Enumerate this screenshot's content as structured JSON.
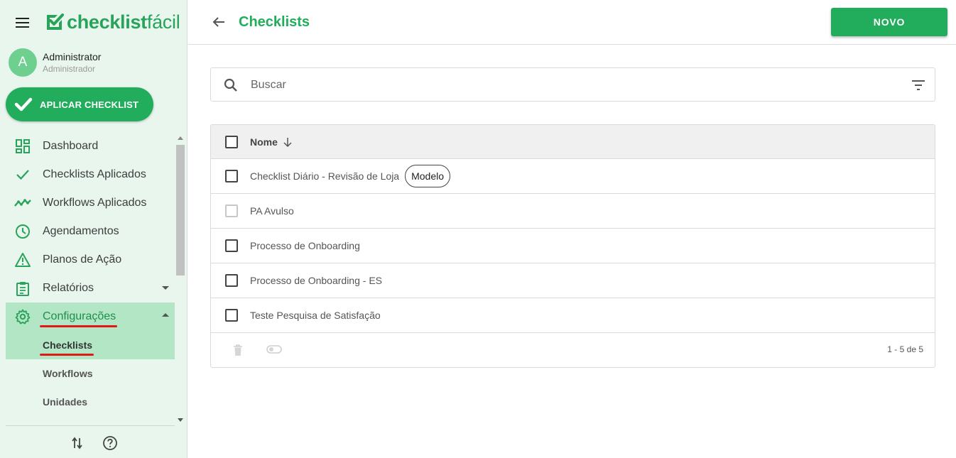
{
  "sidebar": {
    "logo": {
      "bold": "checklist",
      "light": "fácil"
    },
    "user": {
      "initial": "A",
      "name": "Administrator",
      "role": "Administrador"
    },
    "apply_button": "APLICAR CHECKLIST",
    "nav": [
      {
        "label": "Dashboard",
        "icon": "dashboard-icon"
      },
      {
        "label": "Checklists Aplicados",
        "icon": "check-icon"
      },
      {
        "label": "Workflows Aplicados",
        "icon": "trending-icon"
      },
      {
        "label": "Agendamentos",
        "icon": "clock-icon"
      },
      {
        "label": "Planos de Ação",
        "icon": "warning-icon"
      },
      {
        "label": "Relatórios",
        "icon": "clipboard-icon"
      },
      {
        "label": "Configurações",
        "icon": "gear-icon"
      }
    ],
    "sub": [
      {
        "label": "Checklists"
      },
      {
        "label": "Workflows"
      },
      {
        "label": "Unidades"
      }
    ]
  },
  "header": {
    "title": "Checklists",
    "new_button": "NOVO"
  },
  "search": {
    "placeholder": "Buscar"
  },
  "table": {
    "column": "Nome",
    "rows": [
      {
        "name": "Checklist Diário - Revisão de Loja",
        "badge": "Modelo"
      },
      {
        "name": "PA Avulso"
      },
      {
        "name": "Processo de Onboarding"
      },
      {
        "name": "Processo de Onboarding - ES"
      },
      {
        "name": "Teste Pesquisa de Satisfação"
      }
    ],
    "pagination": "1 - 5 de 5"
  },
  "colors": {
    "brand": "#22ad5c",
    "sidebar_bg": "#e8f6ee",
    "active_bg": "#b2e6c5",
    "annotation": "#e01818"
  }
}
